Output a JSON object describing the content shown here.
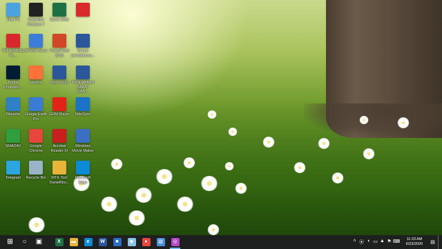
{
  "desktop_icons": [
    {
      "label": "This PC",
      "icon": "computer-icon",
      "color": "#4aa3df"
    },
    {
      "label": "Cyberlink\nYouCam 7",
      "icon": "youcam-icon",
      "color": "#222222"
    },
    {
      "label": "Excel 2016",
      "icon": "excel-icon",
      "color": "#1e7145"
    },
    {
      "label": "",
      "icon": "shortcut-icon",
      "color": "#d92b2b"
    },
    {
      "label": "TELKOMSELFL...",
      "icon": "telkomsel-icon",
      "color": "#d9272e"
    },
    {
      "label": "EPSON Scan",
      "icon": "epson-scan-icon",
      "color": "#3b7dd8"
    },
    {
      "label": "PowerPoint\n2016",
      "icon": "powerpoint-icon",
      "color": "#d24726"
    },
    {
      "label": "format\npendaftaran...",
      "icon": "word-doc-icon",
      "color": "#2b579a"
    },
    {
      "label": "Adobe\nPhotosho...",
      "icon": "photoshop-icon",
      "color": "#001d34"
    },
    {
      "label": "Firefox",
      "icon": "firefox-icon",
      "color": "#ff7139"
    },
    {
      "label": "Word 2016",
      "icon": "word-icon",
      "color": "#2b579a"
    },
    {
      "label": "PENDATAAN\nBAKAT\nDAN...",
      "icon": "word-doc-icon",
      "color": "#2b579a"
    },
    {
      "label": "INavetia",
      "icon": "inavetia-icon",
      "color": "#2f80c8"
    },
    {
      "label": "Google Earth\nPro",
      "icon": "google-earth-icon",
      "color": "#3a7bd5"
    },
    {
      "label": "GOM Player",
      "icon": "gom-player-icon",
      "color": "#e2231a"
    },
    {
      "label": "SideSync",
      "icon": "sidesync-icon",
      "color": "#1a73c9"
    },
    {
      "label": "SMADAV",
      "icon": "smadav-icon",
      "color": "#2e9e3f"
    },
    {
      "label": "Google\nChrome",
      "icon": "chrome-icon",
      "color": "#e8453c"
    },
    {
      "label": "Acrobat\nReader XI",
      "icon": "acrobat-icon",
      "color": "#c81e1e"
    },
    {
      "label": "Windows\nMovie Maker",
      "icon": "movie-maker-icon",
      "color": "#3b6fc4"
    },
    {
      "label": "Telegram",
      "icon": "telegram-icon",
      "color": "#2ca5e0"
    },
    {
      "label": "Recycle Bin",
      "icon": "recycle-bin-icon",
      "color": "#9ab3c8"
    },
    {
      "label": "MTK Tool\nDanieBbo...",
      "icon": "folder-icon",
      "color": "#e8b43a"
    },
    {
      "label": "Microsoft\nEdge",
      "icon": "edge-icon",
      "color": "#0c8ad6"
    }
  ],
  "taskbar": {
    "items": [
      {
        "name": "start-button",
        "icon": "windows-logo-icon",
        "glyph": "⊞",
        "color": "#ffffff",
        "active": false
      },
      {
        "name": "search-button",
        "icon": "search-icon",
        "glyph": "○",
        "color": "#ffffff",
        "active": false
      },
      {
        "name": "task-view-button",
        "icon": "task-view-icon",
        "glyph": "▣",
        "color": "#ffffff",
        "active": false
      },
      {
        "name": "taskbar-excel",
        "icon": "excel-icon",
        "glyph": "X",
        "color": "#1e7145",
        "active": false
      },
      {
        "name": "taskbar-file-explorer",
        "icon": "folder-icon",
        "glyph": "▬",
        "color": "#e8b43a",
        "active": false
      },
      {
        "name": "taskbar-edge",
        "icon": "edge-icon",
        "glyph": "e",
        "color": "#0c8ad6",
        "active": false
      },
      {
        "name": "taskbar-word",
        "icon": "word-icon",
        "glyph": "W",
        "color": "#2b579a",
        "active": false
      },
      {
        "name": "taskbar-store",
        "icon": "store-icon",
        "glyph": "■",
        "color": "#2b6cc4",
        "active": false
      },
      {
        "name": "taskbar-app",
        "icon": "app-icon",
        "glyph": "◆",
        "color": "#8cc4e8",
        "active": false
      },
      {
        "name": "taskbar-chrome",
        "icon": "chrome-icon",
        "glyph": "●",
        "color": "#e8453c",
        "active": false
      },
      {
        "name": "taskbar-paint",
        "icon": "paint-icon",
        "glyph": "▧",
        "color": "#4a90d9",
        "active": false
      },
      {
        "name": "taskbar-youcam",
        "icon": "youcam-icon",
        "glyph": "◎",
        "color": "#b44ac4",
        "active": true
      }
    ],
    "tray": {
      "icons": [
        "chevron-up-icon",
        "network-icon",
        "volume-icon",
        "battery-icon",
        "shield-icon",
        "flag-icon",
        "keyboard-icon"
      ],
      "glyphs": [
        "˄",
        "⦿",
        "◖",
        "▭",
        "▲",
        "⚑",
        "⌨"
      ],
      "time": "11:23 AM",
      "date": "6/23/2020",
      "notification_icon": "notification-icon",
      "notification_glyph": "▤"
    }
  }
}
